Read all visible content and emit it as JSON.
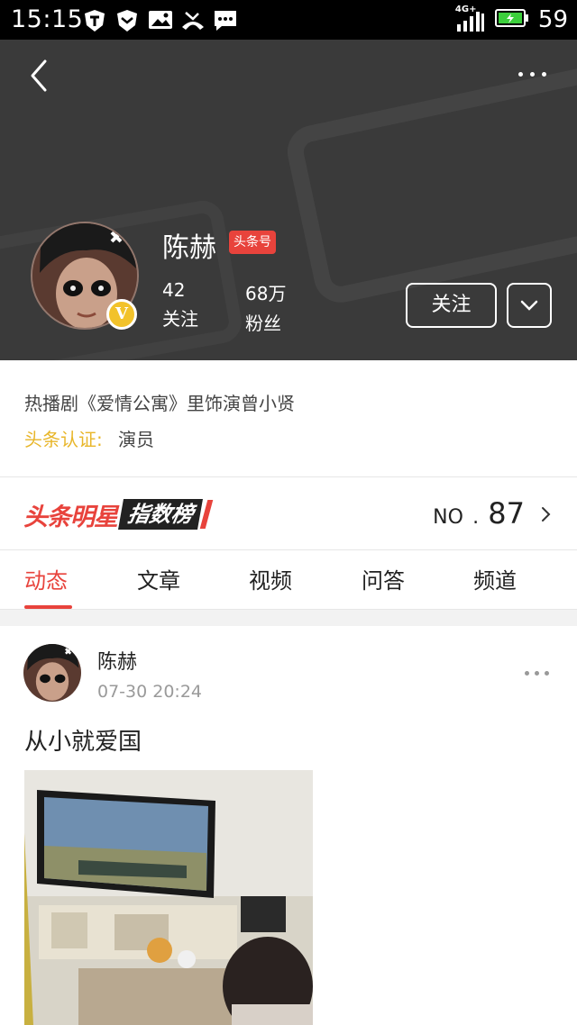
{
  "status_bar": {
    "time": "15:15",
    "network": "4G+",
    "battery": "59"
  },
  "profile": {
    "name": "陈赫",
    "media_badge": "头条号",
    "following_count": "42",
    "following_label": "关注",
    "fans_count": "68万",
    "fans_label": "粉丝",
    "follow_button": "关注"
  },
  "bio": {
    "description": "热播剧《爱情公寓》里饰演曾小贤",
    "verify_label": "头条认证:",
    "verify_value": "演员"
  },
  "star_rank": {
    "logo_part1": "头条明星",
    "logo_part2": "指数榜",
    "rank_prefix": "NO",
    "rank_sep": ".",
    "rank_value": "87"
  },
  "tabs": [
    {
      "label": "动态",
      "active": true
    },
    {
      "label": "文章",
      "active": false
    },
    {
      "label": "视频",
      "active": false
    },
    {
      "label": "问答",
      "active": false
    },
    {
      "label": "频道",
      "active": false
    }
  ],
  "feed": {
    "author": "陈赫",
    "time": "07-30 20:24",
    "text": "从小就爱国"
  },
  "colors": {
    "accent": "#e8433c",
    "verify": "#e8b62a",
    "header_bg": "#3a3a3a"
  },
  "icons": [
    "back-icon",
    "more-icon",
    "chevron-down-icon",
    "chevron-right-icon",
    "verified-icon"
  ]
}
